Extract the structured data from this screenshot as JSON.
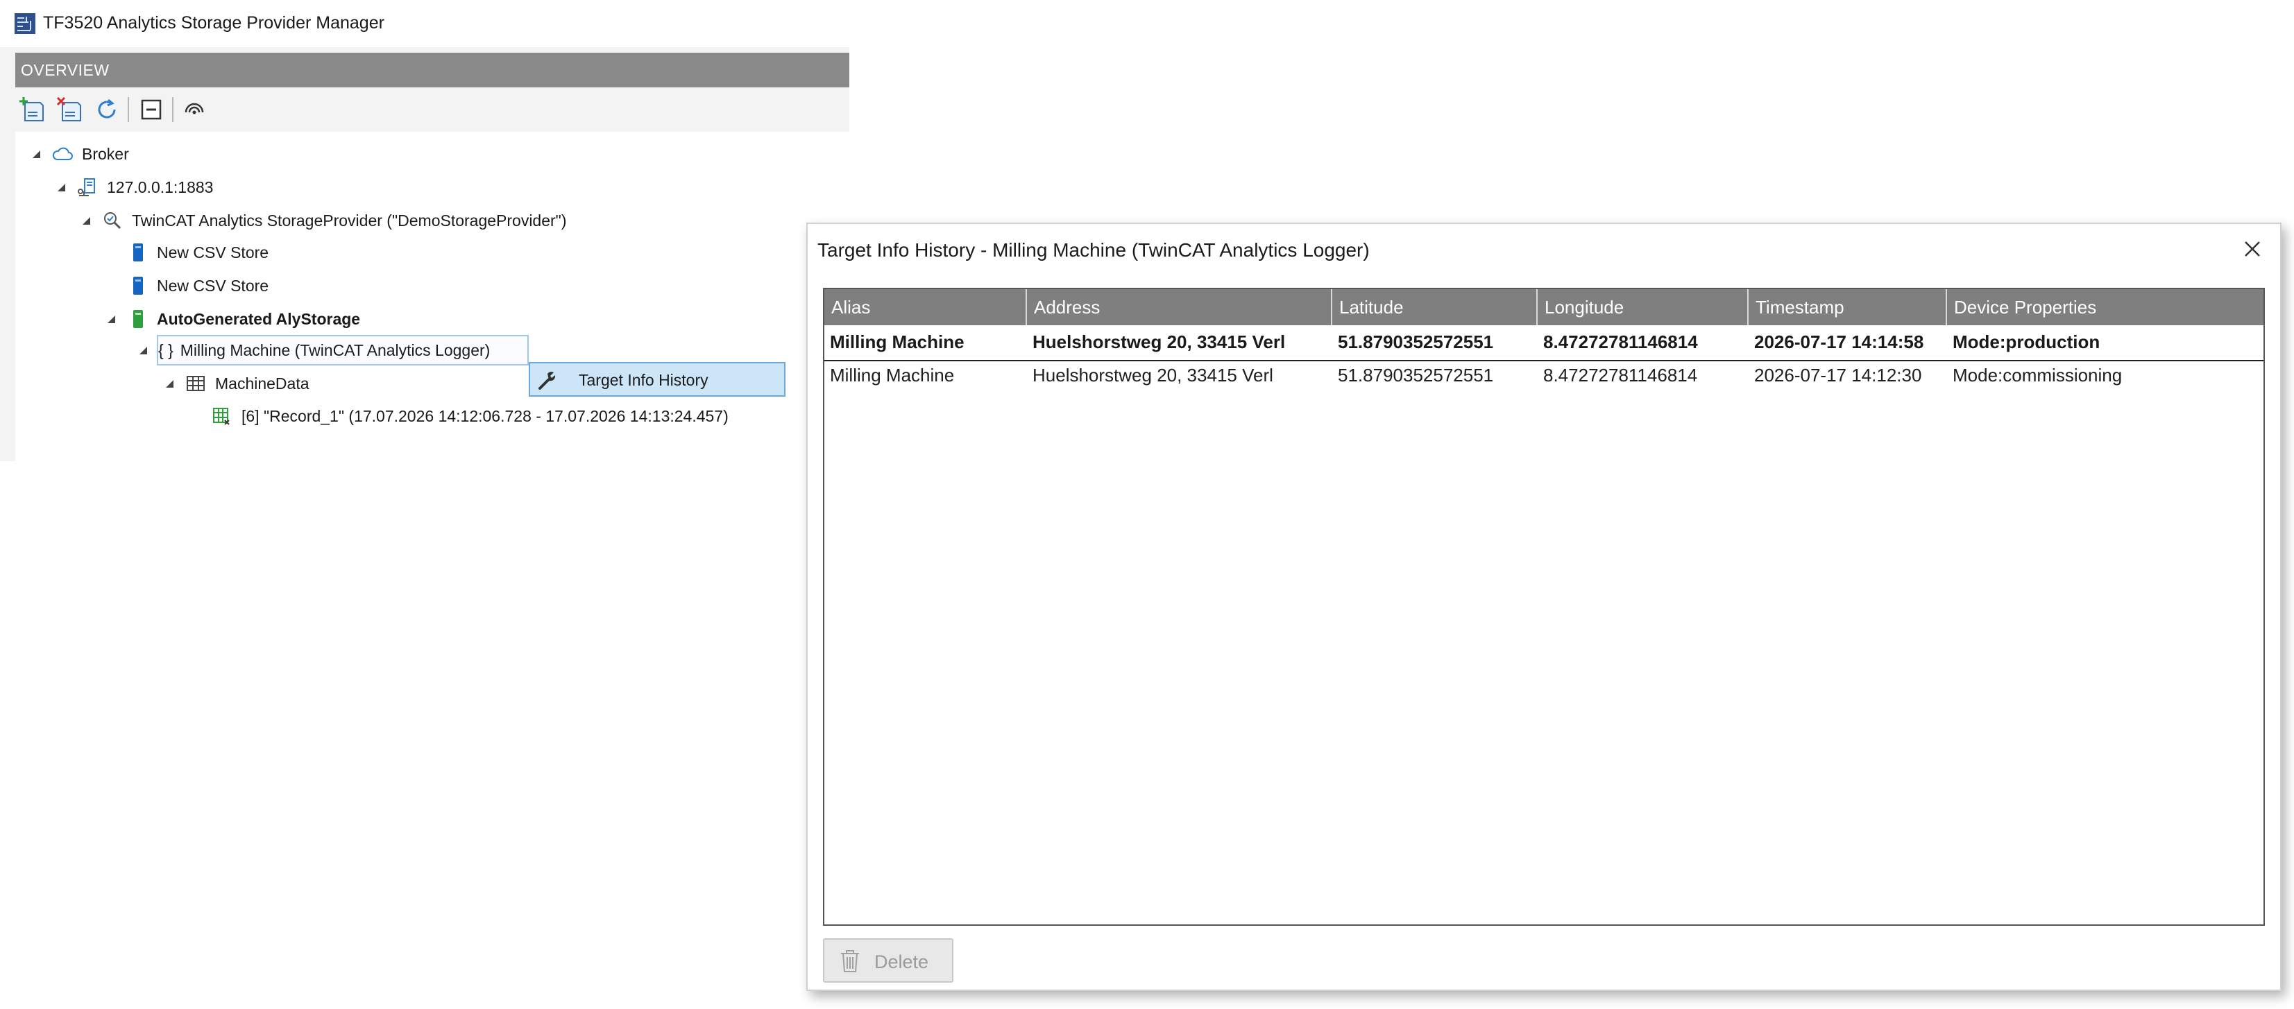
{
  "window": {
    "title": "TF3520 Analytics Storage Provider Manager"
  },
  "overview": {
    "header": "OVERVIEW",
    "toolbar": [
      {
        "icon": "add-storage-icon"
      },
      {
        "icon": "remove-storage-icon"
      },
      {
        "icon": "refresh-icon"
      },
      {
        "icon": "collapse-all-icon"
      },
      {
        "icon": "watch-icon"
      }
    ]
  },
  "tree": {
    "broker": "Broker",
    "host": "127.0.0.1:1883",
    "provider": "TwinCAT Analytics StorageProvider (\"DemoStorageProvider\")",
    "csv_store_1": "New CSV Store",
    "csv_store_2": "New CSV Store",
    "autogen": "AutoGenerated AlyStorage",
    "logger_brace": "{ }",
    "logger": "Milling Machine  (TwinCAT Analytics Logger)",
    "machinedata": "MachineData",
    "record": "[6] \"Record_1\" (17.07.2026 14:12:06.728 - 17.07.2026 14:13:24.457)"
  },
  "context_menu": {
    "item": "Target Info History"
  },
  "dialog": {
    "title": "Target Info History - Milling Machine  (TwinCAT Analytics Logger)",
    "columns": [
      "Alias",
      "Address",
      "Latitude",
      "Longitude",
      "Timestamp",
      "Device Properties"
    ],
    "rows": [
      [
        "Milling Machine",
        "Huelshorstweg 20, 33415 Verl",
        "51.8790352572551",
        "8.47272781146814",
        "2026-07-17 14:14:58",
        "Mode:production"
      ],
      [
        "Milling Machine",
        "Huelshorstweg 20, 33415 Verl",
        "51.8790352572551",
        "8.47272781146814",
        "2026-07-17 14:12:30",
        "Mode:commissioning"
      ]
    ],
    "delete_label": "Delete"
  },
  "colors": {
    "header_gray": "#8a8a8a",
    "grid_header": "#7f7f7f",
    "selection": "#cde6f7",
    "store_blue": "#1565c0",
    "store_green": "#2e9e3e"
  }
}
